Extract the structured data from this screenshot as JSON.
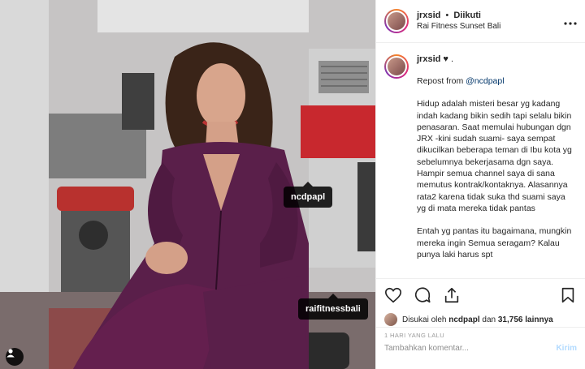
{
  "header": {
    "username": "jrxsid",
    "separator": "•",
    "follow_status": "Diikuti",
    "location": "Rai Fitness Sunset Bali",
    "more_icon": "more-horizontal-icon"
  },
  "caption": {
    "username": "jrxsid",
    "user_suffix": "♥ .",
    "repost_label": "Repost from",
    "repost_mention": "@ncdpapl",
    "paragraph1": "Hidup adalah misteri besar yg kadang indah kadang bikin sedih tapi selalu bikin penasaran. Saat memulai hubungan dgn JRX -kini sudah suami- saya sempat dikucilkan beberapa teman di Ibu kota yg sebelumnya bekerjasama dgn saya. Hampir semua channel saya di sana memutus kontrak/kontaknya. Alasannya rata2 karena tidak suka thd suami saya yg di mata mereka tidak pantas",
    "paragraph2": "Entah yg pantas itu bagaimana, mungkin mereka ingin Semua seragam? Kalau punya laki harus spt"
  },
  "photo_tags": [
    {
      "label": "ncdpapl"
    },
    {
      "label": "raifitnessbali"
    }
  ],
  "actions": {
    "like_icon": "heart-icon",
    "comment_icon": "comment-icon",
    "share_icon": "share-icon",
    "save_icon": "bookmark-icon"
  },
  "likes": {
    "prefix": "Disukai oleh",
    "first_liker": "ncdpapl",
    "conjunction": "dan",
    "count": "31,756",
    "suffix": "lainnya"
  },
  "timestamp": "1 HARI YANG LALU",
  "comment_box": {
    "placeholder": "Tambahkan komentar...",
    "post_label": "Kirim"
  },
  "colors": {
    "outfit": "#5a1f4a",
    "hair": "#3a2418",
    "gym_red": "#c8282e",
    "post_button": "#b3dbff"
  }
}
